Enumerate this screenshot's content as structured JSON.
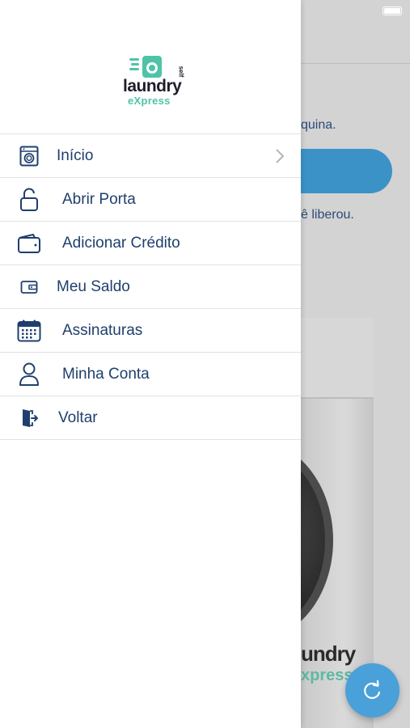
{
  "background": {
    "line_1": "quina.",
    "line_2": "ê liberou.",
    "machine_logo_word": "undry",
    "machine_logo_express": "xpress"
  },
  "drawer": {
    "logo": {
      "self": "self",
      "word": "laundry",
      "express": "eXpress"
    },
    "items": [
      {
        "label": "Início",
        "icon": "washing-machine-icon",
        "has_chevron": true
      },
      {
        "label": "Abrir Porta",
        "icon": "unlock-icon"
      },
      {
        "label": "Adicionar Crédito",
        "icon": "wallet-icon"
      },
      {
        "label": "Meu Saldo",
        "icon": "small-wallet-icon"
      },
      {
        "label": "Assinaturas",
        "icon": "calendar-icon"
      },
      {
        "label": "Minha Conta",
        "icon": "user-icon"
      },
      {
        "label": "Voltar",
        "icon": "exit-door-icon"
      }
    ]
  },
  "fab": {
    "icon": "refresh-icon"
  },
  "colors": {
    "accent": "#3b92c7",
    "text": "#1f3f6e",
    "brand_green": "#4fc3a8"
  }
}
